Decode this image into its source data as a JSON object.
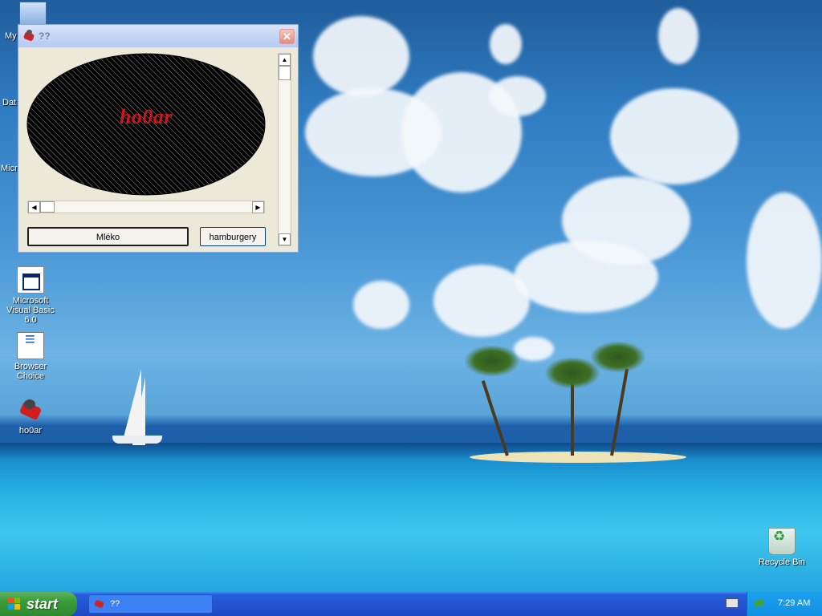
{
  "window": {
    "title": "??",
    "ellipse_text": "ho0ar",
    "buttons": {
      "first": "Mléko",
      "second": "hamburgery"
    }
  },
  "desktop_icons": [
    {
      "label": "Microsoft Visual Basic 6.0"
    },
    {
      "label": "Browser Choice"
    },
    {
      "label": "ho0ar"
    },
    {
      "label": "Recycle Bin"
    }
  ],
  "partial_labels": {
    "my": "My",
    "dat": "Dat",
    "micr": "Micro"
  },
  "taskbar": {
    "start_label": "start",
    "window_button": "??",
    "clock": "7:29 AM"
  },
  "colors": {
    "accent_red": "#d2151b",
    "taskbar_blue": "#245edb",
    "start_green": "#3a9b3a"
  }
}
